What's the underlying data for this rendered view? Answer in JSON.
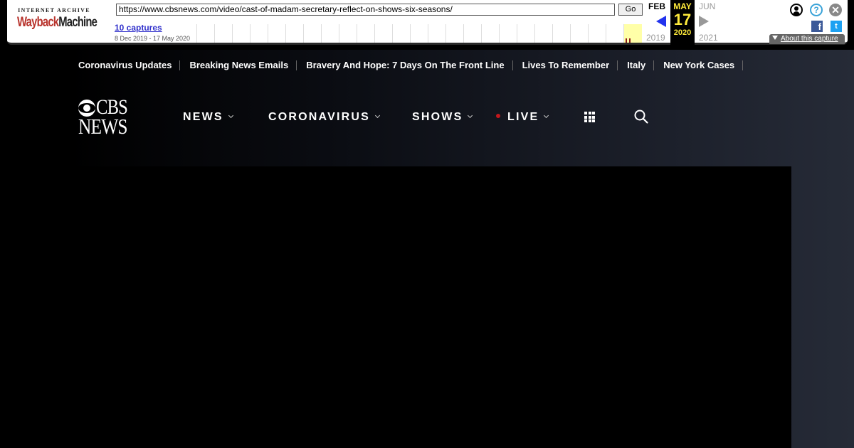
{
  "wayback": {
    "logo_top": "INTERNET ARCHIVE",
    "logo_word1": "Wayback",
    "logo_word2": "Machine",
    "url": "https://www.cbsnews.com/video/cast-of-madam-secretary-reflect-on-shows-six-seasons/",
    "go_label": "Go",
    "captures": "10 captures",
    "range": "8 Dec 2019 - 17 May 2020",
    "prev_month": "FEB",
    "cur_month": "MAY",
    "next_month": "JUN",
    "cur_day": "17",
    "prev_year": "2019",
    "cur_year": "2020",
    "next_year": "2021",
    "help_glyph": "?",
    "close_glyph": "✕",
    "facebook_glyph": "f",
    "twitter_glyph": "t",
    "about_label": "About this capture",
    "colors": {
      "highlight": "#ffeb3b",
      "link": "#3333cc",
      "prev_arrow": "#2233ee"
    }
  },
  "trending": [
    "Coronavirus Updates",
    "Breaking News Emails",
    "Bravery And Hope: 7 Days On The Front Line",
    "Lives To Remember",
    "Italy",
    "New York Cases"
  ],
  "header": {
    "logo_top": "CBS",
    "logo_bottom": "NEWS",
    "nav": [
      "NEWS",
      "CORONAVIRUS",
      "SHOWS",
      "LIVE"
    ],
    "icons": [
      "grid-icon",
      "search-icon"
    ],
    "colors": {
      "live_dot": "#c4171c"
    }
  }
}
